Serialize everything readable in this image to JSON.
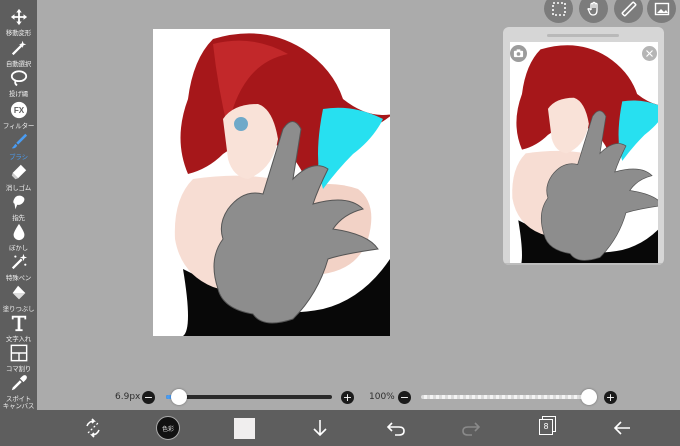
{
  "toolbar": {
    "tools": [
      {
        "label": "移動変形",
        "icon": "move-icon",
        "active": false
      },
      {
        "label": "自動選択",
        "icon": "magic-wand-icon",
        "active": false
      },
      {
        "label": "投げ縄",
        "icon": "lasso-icon",
        "active": false
      },
      {
        "label": "フィルター",
        "icon": "fx-icon",
        "active": false
      },
      {
        "label": "ブラシ",
        "icon": "brush-icon",
        "active": true
      },
      {
        "label": "消しゴム",
        "icon": "eraser-icon",
        "active": false
      },
      {
        "label": "指先",
        "icon": "finger-icon",
        "active": false
      },
      {
        "label": "ぼかし",
        "icon": "blur-drop-icon",
        "active": false
      },
      {
        "label": "特殊ペン",
        "icon": "special-pen-icon",
        "active": false
      },
      {
        "label": "塗りつぶし",
        "icon": "bucket-icon",
        "active": false
      },
      {
        "label": "文字入れ",
        "icon": "text-icon",
        "active": false
      },
      {
        "label": "コマ割り",
        "icon": "frame-divider-icon",
        "active": false
      },
      {
        "label": "スポイト",
        "icon": "eyedropper-icon",
        "active": false
      },
      {
        "label": "キャンバス",
        "icon": "canvas-icon",
        "active": false
      }
    ]
  },
  "sliders": {
    "brush_size": {
      "label": "6.9px",
      "value": 0.08
    },
    "opacity": {
      "label": "100%",
      "value": 1.0
    }
  },
  "bottombar": {
    "color_label": "色彩",
    "layer_count": "8"
  },
  "colors": {
    "accent": "#4a9cf2",
    "toolbar_bg": "#5e5e5e",
    "workspace_bg": "#ababab",
    "primary_color": "#111111",
    "secondary_color": "#f0eeee"
  }
}
